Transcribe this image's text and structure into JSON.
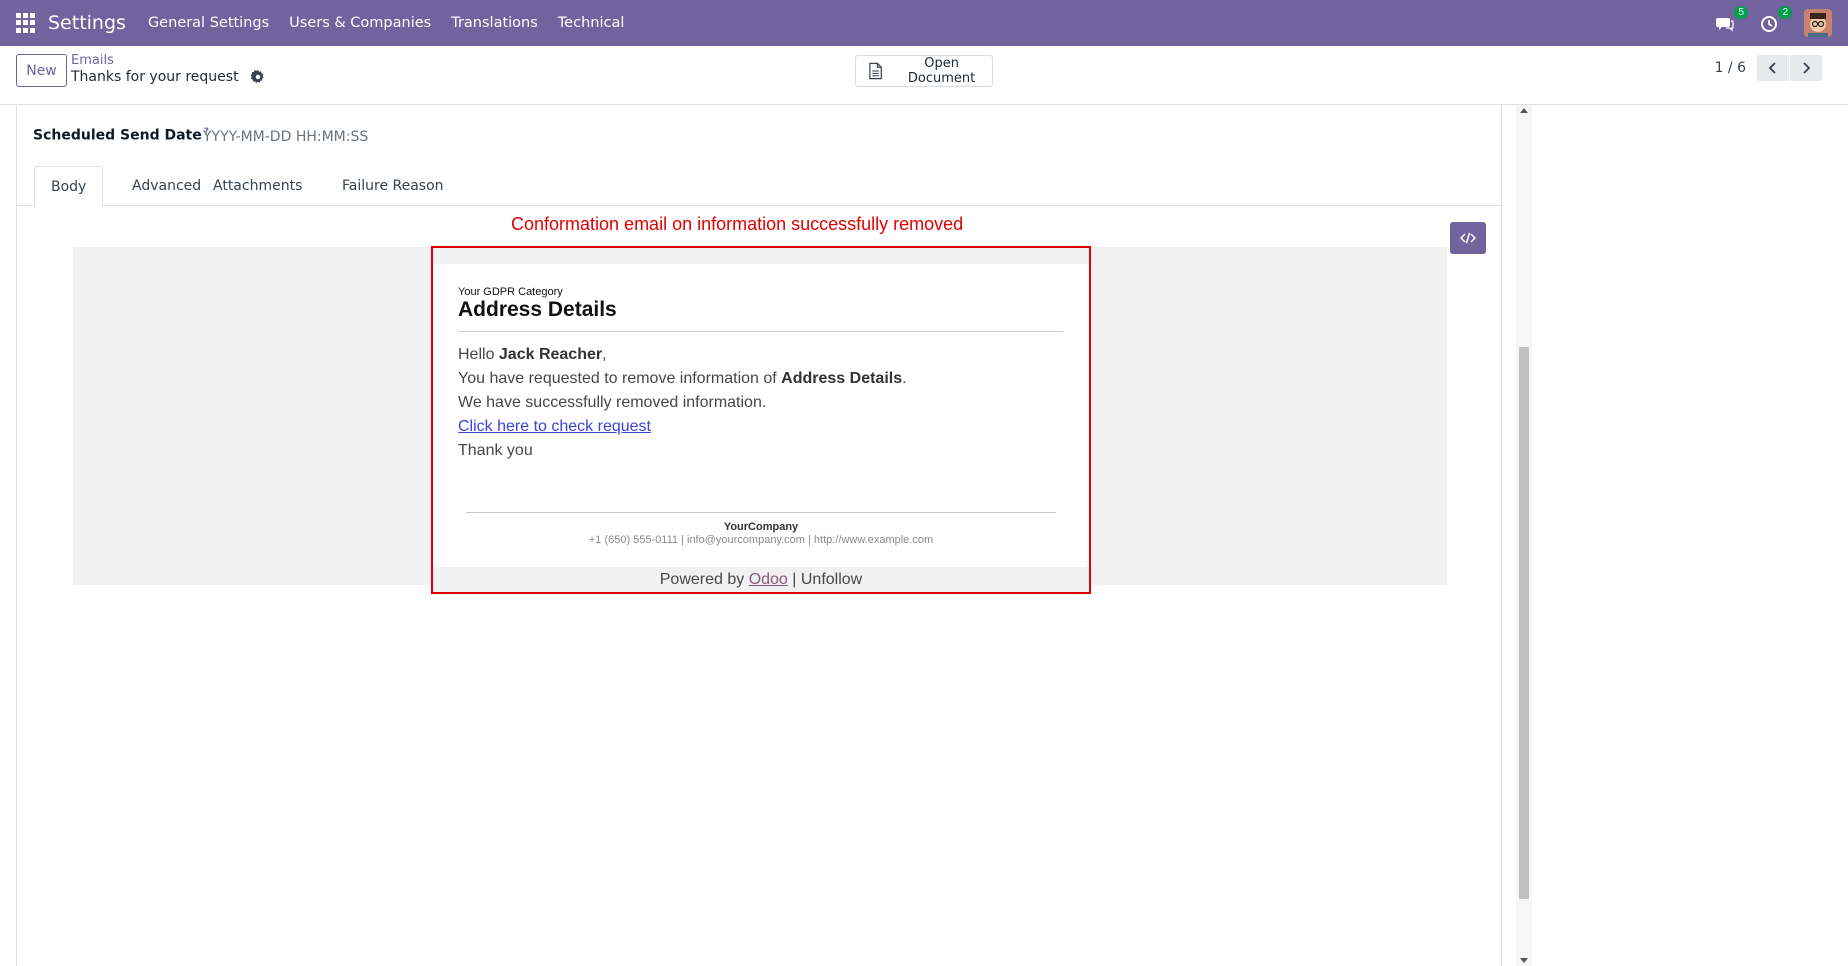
{
  "navbar": {
    "brand": "Settings",
    "menu": [
      "General Settings",
      "Users & Companies",
      "Translations",
      "Technical"
    ],
    "messages_count": "5",
    "activities_count": "2",
    "bg_color": "#71639e"
  },
  "control": {
    "new_label": "New",
    "breadcrumb_parent": "Emails",
    "breadcrumb_current": "Thanks for your request",
    "open_document_label": "Open Document",
    "pager": "1 / 6"
  },
  "form": {
    "scheduled_label": "Scheduled Send Date",
    "scheduled_help": "?",
    "scheduled_placeholder": "YYYY-MM-DD HH:MM:SS",
    "tabs": [
      "Body",
      "Advanced",
      "Attachments",
      "Failure Reason"
    ],
    "active_tab": "Body"
  },
  "annotation": "Conformation email on information successfully removed",
  "email": {
    "category": "Your GDPR Category",
    "title": "Address Details",
    "greeting_prefix": "Hello ",
    "greeting_name": "Jack Reacher",
    "greeting_suffix": ",",
    "line2_prefix": "You have requested to remove information of ",
    "line2_bold": "Address Details",
    "line2_suffix": ".",
    "line3": "We have successfully removed information.",
    "link_text": "Click here to check request",
    "closing": "Thank you",
    "company": "YourCompany",
    "contact": "+1 (650) 555-0111 | info@yourcompany.com | http://www.example.com",
    "powered_prefix": "Powered by ",
    "powered_link": "Odoo",
    "powered_suffix": " | Unfollow"
  }
}
